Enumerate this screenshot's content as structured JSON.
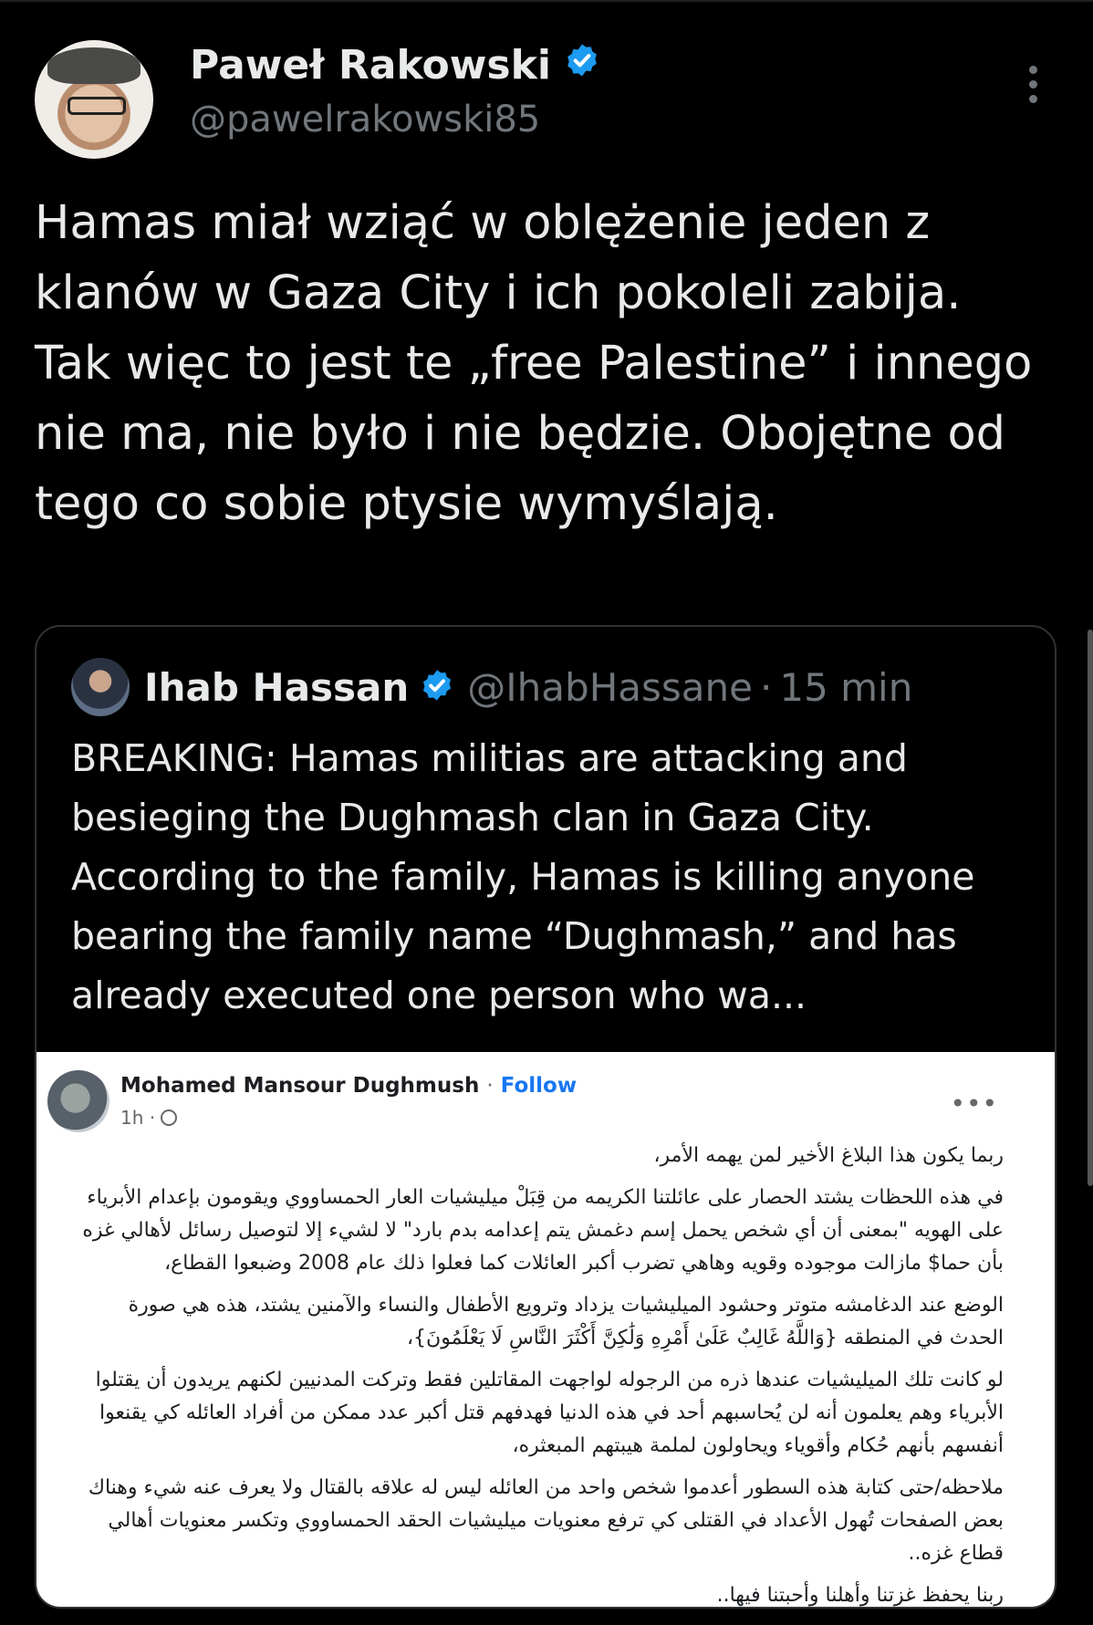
{
  "tweet": {
    "author_name": "Paweł Rakowski",
    "author_handle": "@pawelrakowski85",
    "text": "Hamas miał wziąć w oblężenie jeden z klanów w Gaza City i ich pokoleli zabija. Tak więc to jest te „free Palestine” i innego nie ma, nie było i nie będzie. Obojętne od tego co sobie ptysie wymyślają."
  },
  "quoted_tweet": {
    "author_name": "Ihab Hassan",
    "author_handle": "@IhabHassane",
    "separator": "·",
    "time": "15 min",
    "text": "BREAKING: Hamas militias are attacking and besieging the Dughmash clan in Gaza City. According to the family, Hamas is killing anyone bearing the family name “Dughmash,” and has already executed one person who wa..."
  },
  "fb_post": {
    "author_name": "Mohamed Mansour Dughmush",
    "separator": "·",
    "follow_label": "Follow",
    "time": "1h ·",
    "more": "•••",
    "paragraphs": [
      "ربما يكون هذا البلاغ الأخير لمن يهمه الأمر،",
      "في هذه اللحظات يشتد الحصار على عائلتنا الكريمه من قِبَلْ ميليشيات العار الحمساووي ويقومون بإعدام الأبرياء على الهويه \"بمعنى أن أي شخص يحمل إسم دغمش يتم إعدامه بدم بارد\" لا لشيء إلا لتوصيل رسائل لأهالي غزه بأن حما$ مازالت موجوده وقويه وهاهي تضرب أكبر العائلات كما فعلوا ذلك عام 2008 وضبعوا القطاع،",
      "الوضع عند الدغامشه متوتر وحشود الميليشيات يزداد وترويع الأطفال والنساء والآمنين يشتد، هذه هي صورة الحدث في المنطقه {وَاللَّهُ غَالِبٌ عَلَىٰ أَمْرِهِ وَلَٰكِنَّ أَكْثَرَ النَّاسِ لَا يَعْلَمُونَ}،",
      "لو كانت تلك الميليشيات عندها ذره من الرجوله لواجهت المقاتلين فقط وتركت المدنيين لكنهم يريدون أن يقتلوا الأبرياء وهم يعلمون أنه لن يُحاسبهم أحد في هذه الدنيا فهدفهم قتل أكبر عدد ممكن من أفراد العائله كي يقنعوا أنفسهم بأنهم حُكام وأقوياء ويحاولون لملمة هيبتهم المبعثره،",
      "ملاحظه/حتى كتابة هذه السطور أعدموا شخص واحد من العائله ليس له علاقه بالقتال ولا يعرف عنه شيء وهناك بعض الصفحات تُهول الأعداد في القتلى كي ترفع معنويات ميليشيات الحقد الحمساووي وتكسر معنويات أهالي قطاع غزه..",
      "ربنا يحفظ غزتنا وأهلنا وأحبتنا فيها.."
    ]
  },
  "colors": {
    "background": "#000000",
    "text_primary": "#e7e9ea",
    "text_secondary": "#71767b",
    "verified": "#1d9bf0",
    "facebook_blue": "#1877f2"
  },
  "icons": [
    "verified-badge-icon",
    "more-options-icon",
    "globe-icon"
  ]
}
